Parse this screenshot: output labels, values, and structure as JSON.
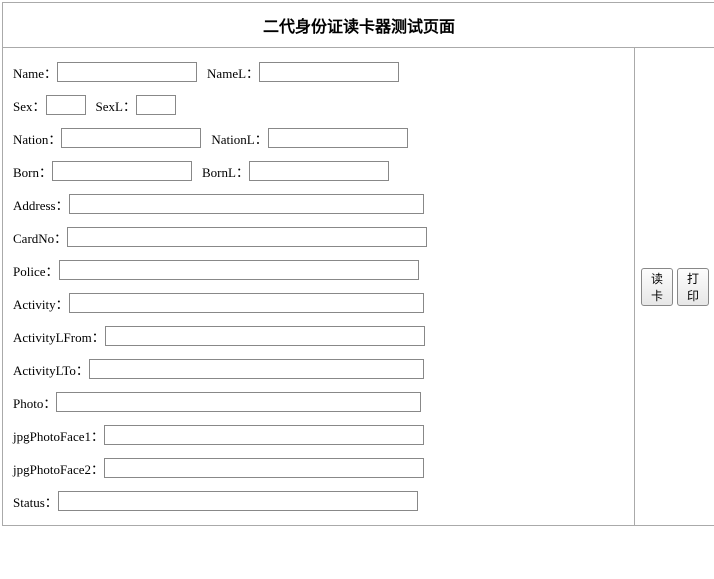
{
  "title": "二代身份证读卡器测试页面",
  "labels": {
    "name": "Name：",
    "nameL": "NameL：",
    "sex": "Sex：",
    "sexL": "SexL：",
    "nation": "Nation：",
    "nationL": "NationL：",
    "born": "Born：",
    "bornL": "BornL：",
    "address": "Address：",
    "cardNo": "CardNo：",
    "police": "Police：",
    "activity": "Activity：",
    "activityLFrom": "ActivityLFrom：",
    "activityLTo": "ActivityLTo：",
    "photo": "Photo：",
    "jpgPhotoFace1": "jpgPhotoFace1：",
    "jpgPhotoFace2": "jpgPhotoFace2：",
    "status": "Status："
  },
  "values": {
    "name": "",
    "nameL": "",
    "sex": "",
    "sexL": "",
    "nation": "",
    "nationL": "",
    "born": "",
    "bornL": "",
    "address": "",
    "cardNo": "",
    "police": "",
    "activity": "",
    "activityLFrom": "",
    "activityLTo": "",
    "photo": "",
    "jpgPhotoFace1": "",
    "jpgPhotoFace2": "",
    "status": ""
  },
  "buttons": {
    "readCard": "读卡",
    "print": "打印"
  }
}
